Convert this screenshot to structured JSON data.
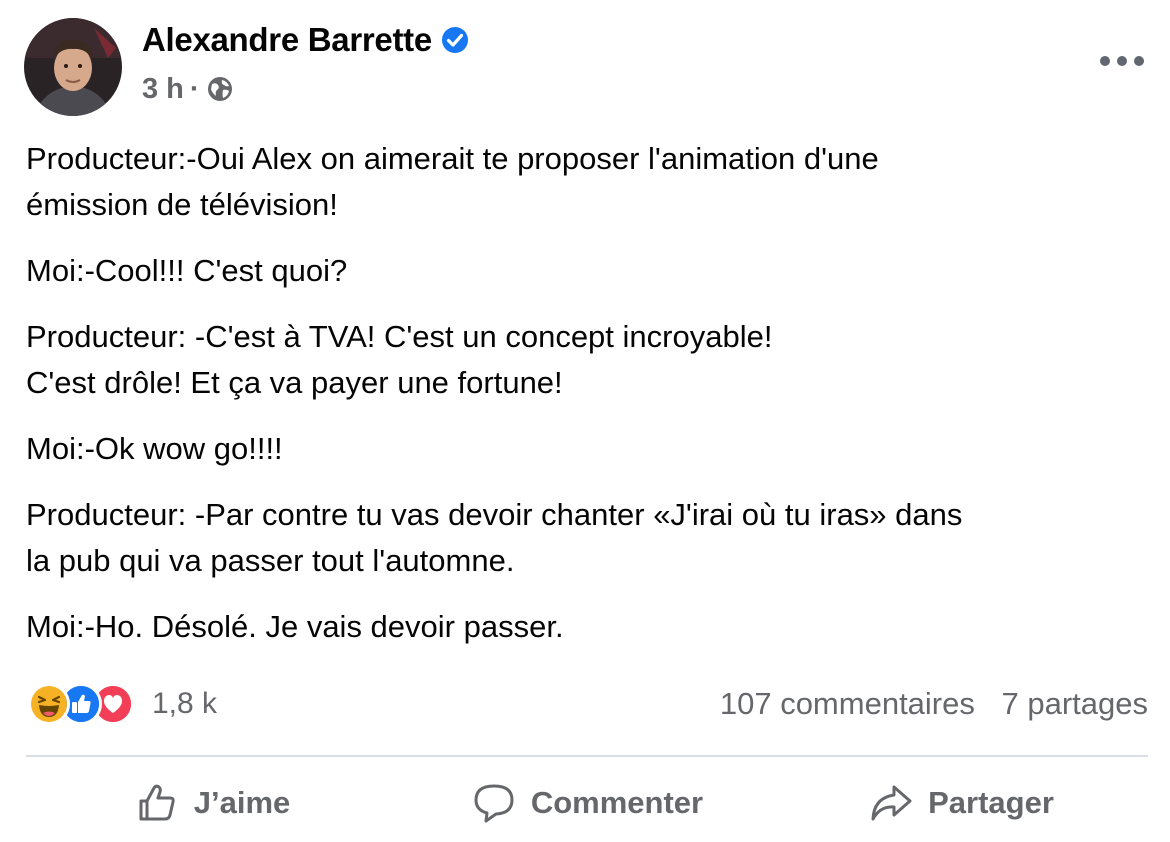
{
  "post": {
    "author": "Alexandre Barrette",
    "verified": true,
    "timestamp": "3 h",
    "separator": "·",
    "audience_icon": "globe-icon",
    "more_icon": "more-options-icon",
    "body": [
      "Producteur:-Oui Alex on aimerait te proposer l'animation d'une\némission de télévision!",
      "Moi:-Cool!!!  C'est quoi?",
      "Producteur: -C'est à TVA! C'est un concept incroyable!\nC'est drôle!  Et ça va payer une fortune!",
      "Moi:-Ok wow go!!!!",
      "Producteur: -Par contre tu vas devoir chanter «J'irai où tu iras» dans\nla pub qui va passer tout l'automne.",
      "Moi:-Ho. Désolé. Je vais devoir passer."
    ]
  },
  "reactions": {
    "icons": [
      "haha-icon",
      "like-icon",
      "love-icon"
    ],
    "count": "1,8 k"
  },
  "engagement": {
    "comments": "107 commentaires",
    "shares": "7 partages"
  },
  "actions": {
    "like_label": "J’aime",
    "comment_label": "Commenter",
    "share_label": "Partager"
  },
  "colors": {
    "text": "#050505",
    "secondary": "#65676b",
    "verified": "#1877f2",
    "like": "#1877f2",
    "love": "#f33e58",
    "haha": "#f7b125",
    "divider": "#dadde1"
  }
}
